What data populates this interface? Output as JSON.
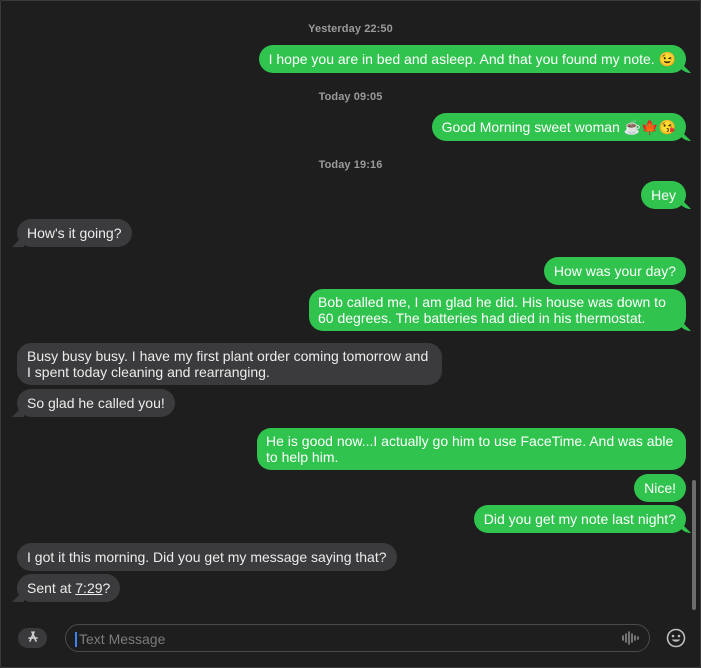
{
  "timestamps": [
    "Yesterday 22:50",
    "Today 09:05",
    "Today 19:16"
  ],
  "messages": {
    "m1": "I hope you are in bed and asleep. And that you found my note. 😉",
    "m2": "Good Morning sweet woman ☕🍁😘",
    "m3": "Hey",
    "m4": "How's it going?",
    "m5": "How was your day?",
    "m6": "Bob called me, I am glad he did. His house was down to 60 degrees. The batteries had died in his thermostat.",
    "m7": "Busy busy busy.  I have my first plant order coming tomorrow and I spent today cleaning and rearranging.",
    "m8": "So glad he called you!",
    "m9": "He is good now...I actually go him to use FaceTime. And was able to help him.",
    "m10": "Nice!",
    "m11": "Did you get my note last night?",
    "m12": "I got it this morning.  Did you get my message saying that?",
    "m13_prefix": "Sent at ",
    "m13_link": "7:29",
    "m13_suffix": "?"
  },
  "compose": {
    "placeholder": "Text Message"
  },
  "icons": {
    "apps": "app-store-icon",
    "audio": "waveform-icon",
    "emoji": "emoji-icon"
  },
  "colors": {
    "sent": "#30c34e",
    "received": "#3b3b3d",
    "background": "#1e1e1e"
  }
}
